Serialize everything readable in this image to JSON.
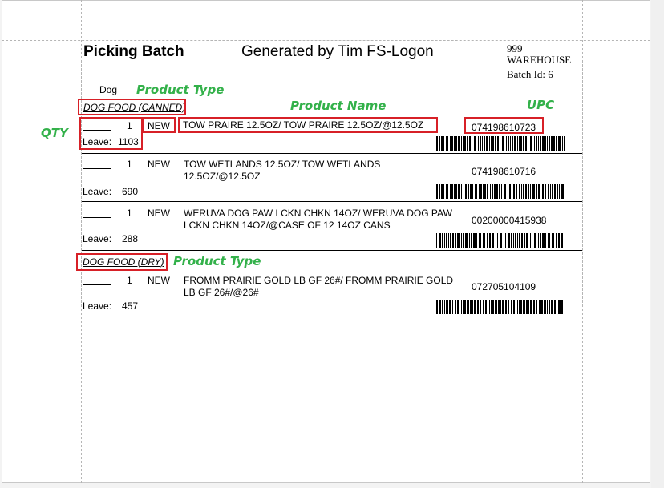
{
  "header": {
    "title": "Picking Batch",
    "generated": "Generated by Tim FS-Logon",
    "warehouse_code": "999",
    "warehouse_label": "WAREHOUSE",
    "batch": "Batch Id: 6"
  },
  "group_label": "Dog",
  "leave_label": "Leave:",
  "annotations": {
    "product_type": "Product Type",
    "product_name": "Product Name",
    "upc": "UPC",
    "qty": "QTY",
    "color": "#33b14a",
    "box_color": "#d72027"
  },
  "categories": [
    {
      "name": "DOG FOOD (CANNED)",
      "items": [
        {
          "qty": "1",
          "status": "NEW",
          "desc1": "TOW PRAIRE 12.5OZ/ TOW PRAIRE 12.5OZ/@12.5OZ",
          "desc2": "",
          "upc": "074198610723",
          "leave": "1103"
        },
        {
          "qty": "1",
          "status": "NEW",
          "desc1": "TOW WETLANDS 12.5OZ/ TOW WETLANDS",
          "desc2": "12.5OZ/@12.5OZ",
          "upc": "074198610716",
          "leave": "690"
        },
        {
          "qty": "1",
          "status": "NEW",
          "desc1": "WERUVA DOG PAW LCKN CHKN 14OZ/ WERUVA DOG PAW",
          "desc2": "LCKN CHKN 14OZ/@CASE OF 12 14OZ CANS",
          "upc": "00200000415938",
          "leave": "288"
        }
      ]
    },
    {
      "name": "DOG FOOD (DRY)",
      "items": [
        {
          "qty": "1",
          "status": "NEW",
          "desc1": "FROMM PRAIRIE GOLD LB GF 26#/ FROMM PRAIRIE GOLD",
          "desc2": "LB GF 26#/@26#",
          "upc": "072705104109",
          "leave": "457"
        }
      ]
    }
  ]
}
